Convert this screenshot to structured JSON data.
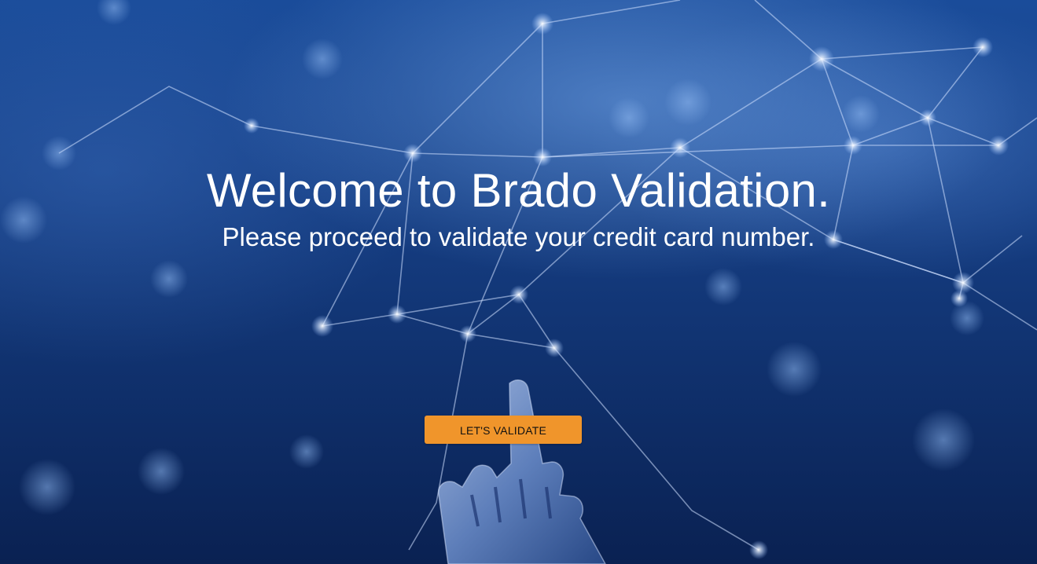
{
  "hero": {
    "title": "Welcome to Brado Validation.",
    "subtitle": "Please proceed to validate your credit card number.",
    "cta_label": "LET'S VALIDATE",
    "background_image": "blue-network-robot-hand"
  },
  "colors": {
    "cta_background": "#f0952b",
    "text": "#ffffff",
    "background": "#163f85"
  }
}
